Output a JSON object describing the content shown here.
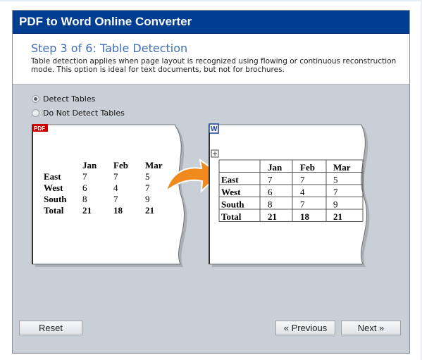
{
  "window": {
    "title": "PDF to Word Online Converter"
  },
  "step": {
    "title": "Step 3 of 6: Table Detection",
    "description": "Table detection applies when page layout is recognized using flowing or continuous reconstruction mode. This option is ideal for text documents, but not for brochures."
  },
  "options": [
    {
      "label": "Detect Tables",
      "selected": true
    },
    {
      "label": "Do Not Detect Tables",
      "selected": false
    }
  ],
  "pdf_page": {
    "badge": "PDF",
    "headers": [
      "",
      "Jan",
      "Feb",
      "Mar"
    ],
    "rows": [
      [
        "East",
        "7",
        "7",
        "5"
      ],
      [
        "West",
        "6",
        "4",
        "7"
      ],
      [
        "South",
        "8",
        "7",
        "9"
      ],
      [
        "Total",
        "21",
        "18",
        "21"
      ]
    ]
  },
  "word_page": {
    "badge": "W",
    "headers": [
      "",
      "Jan",
      "Feb",
      "Mar"
    ],
    "rows": [
      [
        "East",
        "7",
        "7",
        "5"
      ],
      [
        "West",
        "6",
        "4",
        "7"
      ],
      [
        "South",
        "8",
        "7",
        "9"
      ],
      [
        "Total",
        "21",
        "18",
        "21"
      ]
    ]
  },
  "buttons": {
    "reset": "Reset",
    "previous": "« Previous",
    "next": "Next »"
  },
  "colors": {
    "titlebar": "#003e92",
    "step_title": "#3f6fb2",
    "pdf_badge": "#cc0000",
    "word_badge": "#1a3c9a",
    "arrow": "#f08a1e"
  }
}
